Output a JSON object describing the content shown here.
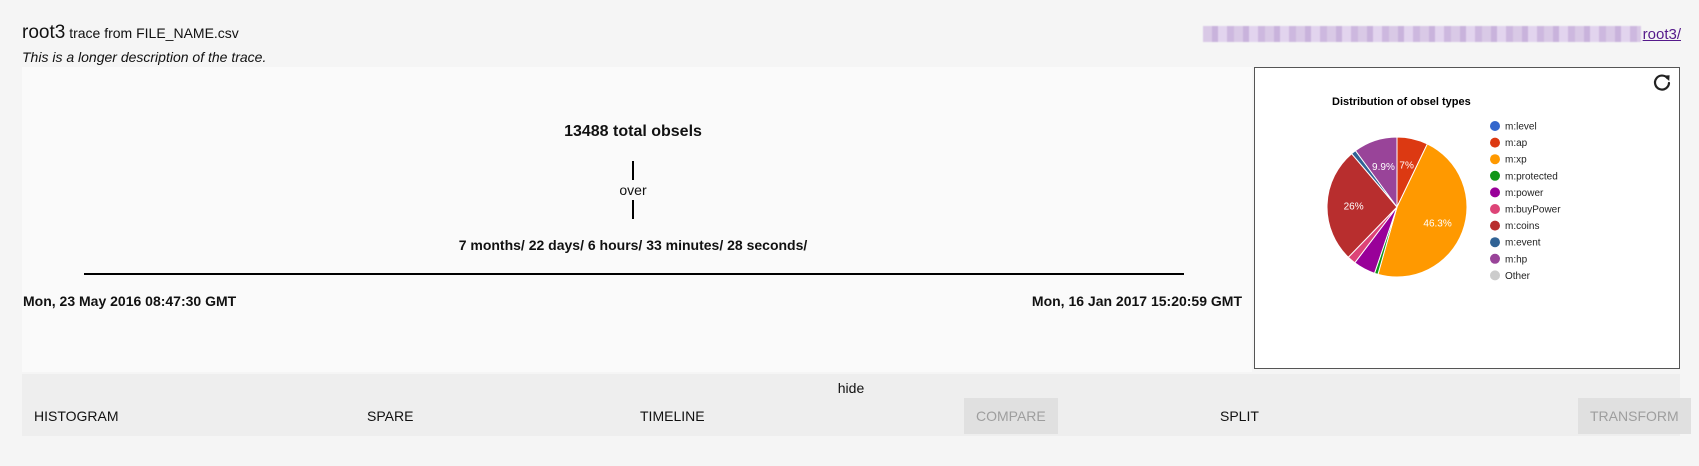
{
  "header": {
    "trace_name": "root3",
    "trace_source": "trace from FILE_NAME.csv",
    "description": "This is a longer description of the trace.",
    "uri_link_label": "root3/"
  },
  "stats": {
    "total": "13488 total obsels",
    "over_label": "over",
    "duration": "7 months/ 22 days/ 6 hours/ 33 minutes/ 28 seconds/",
    "start_date": "Mon, 23 May 2016 08:47:30 GMT",
    "end_date": "Mon, 16 Jan 2017 15:20:59 GMT"
  },
  "chart_panel": {
    "refresh_icon": "refresh-icon"
  },
  "chart_data": {
    "type": "pie",
    "title": "Distribution of obsel types",
    "legend_position": "right",
    "series": [
      {
        "name": "m:level",
        "value": 0.0,
        "color": "#3366cc"
      },
      {
        "name": "m:ap",
        "value": 7.0,
        "color": "#dc3912",
        "label": "7%"
      },
      {
        "name": "m:xp",
        "value": 46.3,
        "color": "#ff9900",
        "label": "46.3%"
      },
      {
        "name": "m:protected",
        "value": 0.8,
        "color": "#109618"
      },
      {
        "name": "m:power",
        "value": 5.0,
        "color": "#990099"
      },
      {
        "name": "m:buyPower",
        "value": 1.9,
        "color": "#dd4477"
      },
      {
        "name": "m:coins",
        "value": 26.0,
        "color": "#b82e2e",
        "label": "26%"
      },
      {
        "name": "m:event",
        "value": 1.1,
        "color": "#316395"
      },
      {
        "name": "m:hp",
        "value": 9.9,
        "color": "#994499",
        "label": "9.9%"
      },
      {
        "name": "Other",
        "value": 0.0,
        "color": "#cccccc"
      }
    ]
  },
  "actions": {
    "hide": "hide",
    "histogram": "Histogram",
    "spare": "Spare",
    "timeline": "Timeline",
    "compare": "Compare",
    "split": "Split",
    "transform": "Transform"
  }
}
